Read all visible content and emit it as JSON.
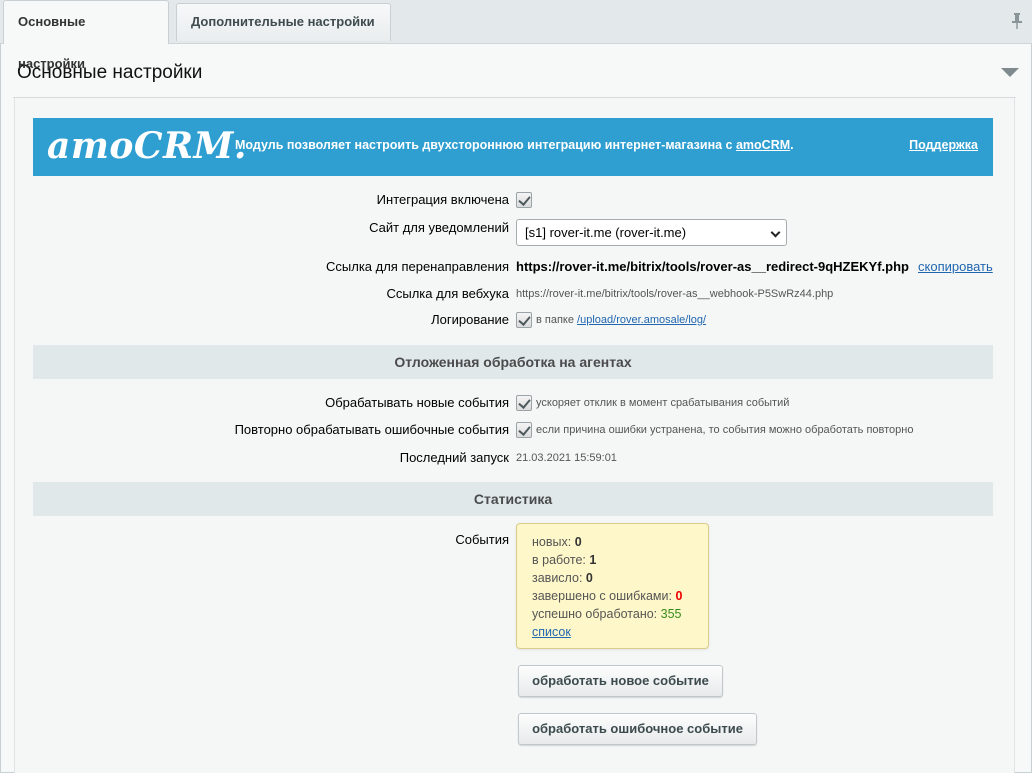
{
  "tabs": [
    {
      "label": "Основные настройки",
      "active": true
    },
    {
      "label": "Дополнительные настройки",
      "active": false
    }
  ],
  "panel": {
    "title": "Основные настройки"
  },
  "banner": {
    "logo": "amoCRM.",
    "text_prefix": "Модуль позволяет настроить двухстороннюю интеграцию интернет-магазина с ",
    "text_link": "amoCRM",
    "text_suffix": ".",
    "support": "Поддержка",
    "color": "#2f9ed1"
  },
  "form": {
    "integration_label": "Интеграция включена",
    "integration_checked": true,
    "site_label": "Сайт для уведомлений",
    "site_value": "[s1] rover-it.me (rover-it.me)",
    "redirect_label": "Ссылка для перенаправления",
    "redirect_value": "https://rover-it.me/bitrix/tools/rover-as__redirect-9qHZEKYf.php",
    "copy_link": "скопировать",
    "webhook_label": "Ссылка для вебхука",
    "webhook_value": "https://rover-it.me/bitrix/tools/rover-as__webhook-P5SwRz44.php",
    "logging_label": "Логирование",
    "logging_checked": true,
    "logging_hint": "в папке ",
    "logging_path": "/upload/rover.amosale/log/"
  },
  "agents": {
    "heading": "Отложенная обработка на агентах",
    "new_events_label": "Обрабатывать новые события",
    "new_events_checked": true,
    "new_events_hint": "ускоряет отклик в момент срабатывания событий",
    "retry_label": "Повторно обрабатывать ошибочные события",
    "retry_checked": true,
    "retry_hint": "если причина ошибки устранена, то события можно обработать повторно",
    "last_run_label": "Последний запуск",
    "last_run_value": "21.03.2021 15:59:01"
  },
  "stats": {
    "heading": "Статистика",
    "events_label": "События",
    "new_label": "новых: ",
    "new_value": "0",
    "in_progress_label": "в работе: ",
    "in_progress_value": "1",
    "stuck_label": "зависло: ",
    "stuck_value": "0",
    "errors_label": "завершено с ошибками: ",
    "errors_value": "0",
    "success_label": "успешно обработано: ",
    "success_value": "355",
    "list_link": "список",
    "error_color": "#ee0000",
    "success_color": "#3a8a1a"
  },
  "buttons": {
    "process_new": "обработать новое событие",
    "process_error": "обработать ошибочное событие"
  }
}
